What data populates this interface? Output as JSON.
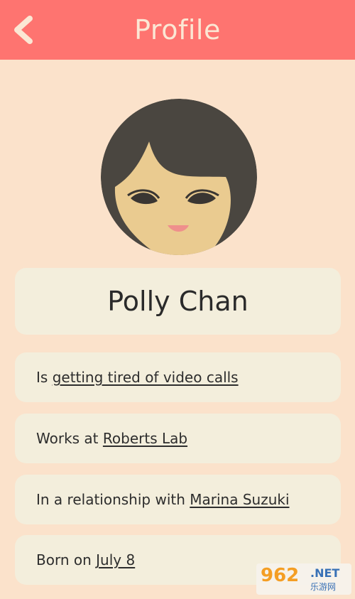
{
  "header": {
    "title": "Profile",
    "back_icon": "chevron-left-icon"
  },
  "profile": {
    "name": "Polly Chan",
    "avatar": "avatar-illustration"
  },
  "info": [
    {
      "prefix": "Is ",
      "link": "getting tired of video calls"
    },
    {
      "prefix": "Works at ",
      "link": "Roberts Lab"
    },
    {
      "prefix": "In a relationship with ",
      "link": "Marina Suzuki"
    },
    {
      "prefix": "Born on ",
      "link": "July 8"
    }
  ],
  "watermark": {
    "number": "962",
    "domain": ".NET",
    "sub": "乐游网"
  },
  "colors": {
    "header": "#fe7470",
    "background": "#fbe2cb",
    "card": "#f3eedc",
    "hair": "#4a4640",
    "skin": "#eacb90"
  }
}
